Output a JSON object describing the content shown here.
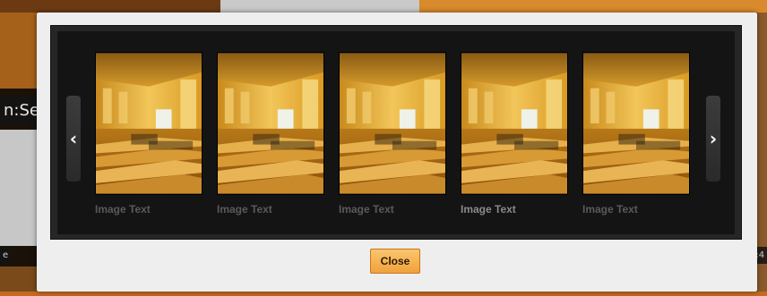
{
  "background": {
    "partial_label_left": "n:Se",
    "partial_label_small_left": "e",
    "partial_label_small_right": "7:4"
  },
  "gallery": {
    "prev_glyph": "‹",
    "next_glyph": "›",
    "items": [
      {
        "caption": "Image Text",
        "selected": false
      },
      {
        "caption": "Image Text",
        "selected": false
      },
      {
        "caption": "Image Text",
        "selected": false
      },
      {
        "caption": "Image Text",
        "selected": true
      },
      {
        "caption": "Image Text",
        "selected": false
      }
    ]
  },
  "modal": {
    "close_label": "Close"
  },
  "colors": {
    "accent": "#f0a23c",
    "viewer_bg": "#141414",
    "modal_bg": "#eeeeee"
  }
}
